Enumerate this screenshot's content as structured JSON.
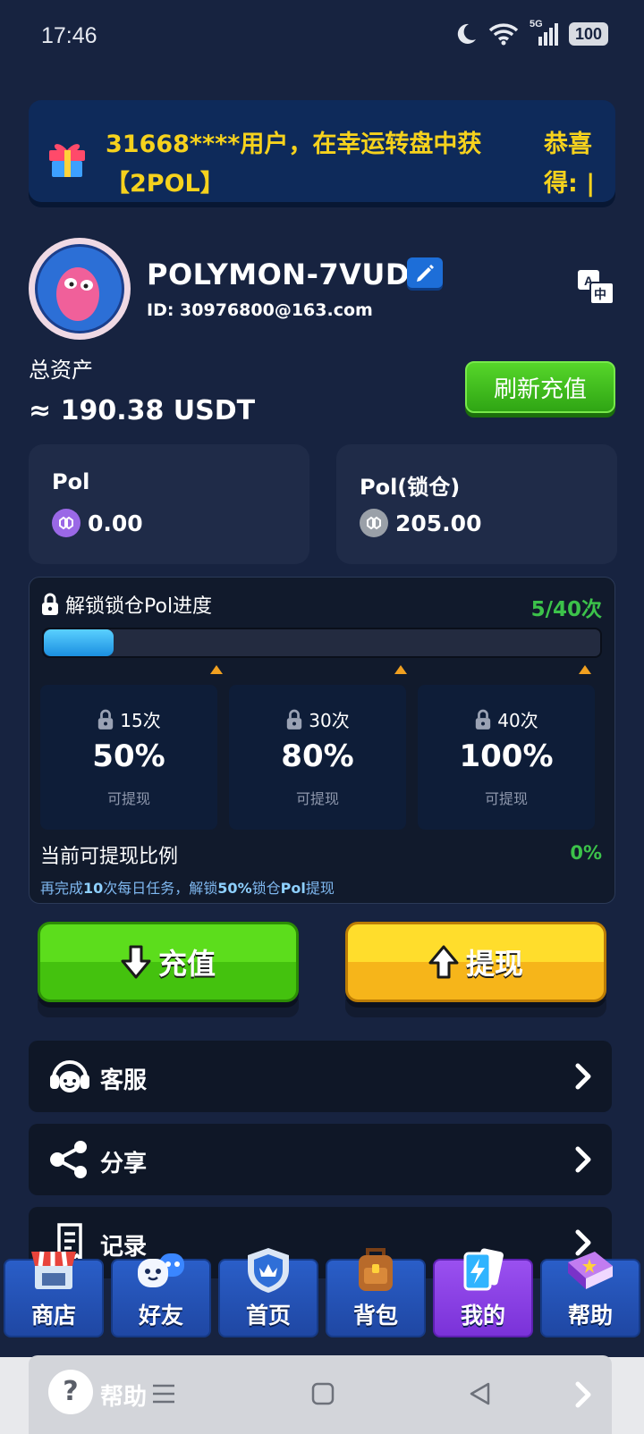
{
  "status_bar": {
    "time": "17:46",
    "network": "5G",
    "battery": "100"
  },
  "banner": {
    "text": "31668****用户，在幸运转盘中获得【2POL】",
    "text_line1": "31668****用户，在幸运转盘中获",
    "text_line2": "【2POL】",
    "right_line1": "恭喜",
    "right_line2": "得: |"
  },
  "profile": {
    "username": "POLYMON-7VUD3",
    "id": "ID: 30976800@163.com"
  },
  "assets": {
    "label": "总资产",
    "value": "≈ 190.38 USDT",
    "refresh_label": "刷新充值"
  },
  "balances": [
    {
      "title": "Pol",
      "value": "0.00",
      "coin_color": "#9a68e6"
    },
    {
      "title": "Pol(锁仓)",
      "value": "205.00",
      "coin_color": "#9aa0a8"
    }
  ],
  "progress": {
    "title": "解锁锁仓Pol进度",
    "count": "5/40次",
    "fraction": 0.125,
    "tiers": [
      {
        "times": "15次",
        "percent": "50%",
        "note": "可提现"
      },
      {
        "times": "30次",
        "percent": "80%",
        "note": "可提现"
      },
      {
        "times": "40次",
        "percent": "100%",
        "note": "可提现"
      }
    ],
    "ratio_label": "当前可提现比例",
    "ratio_value": "0%",
    "hint_a": "再完成",
    "hint_b": "10",
    "hint_c": "次每日任务，解锁",
    "hint_d": "50%",
    "hint_e": "锁仓",
    "hint_f": "Pol",
    "hint_g": "提现"
  },
  "actions": {
    "deposit": "充值",
    "withdraw": "提现"
  },
  "menu": [
    {
      "label": "客服",
      "icon": "headset-icon"
    },
    {
      "label": "分享",
      "icon": "share-icon"
    },
    {
      "label": "记录",
      "icon": "receipt-icon"
    },
    {
      "label": "帮助",
      "icon": "help-icon"
    }
  ],
  "bottom_nav": [
    {
      "label": "商店",
      "icon": "shop-icon"
    },
    {
      "label": "好友",
      "icon": "friends-icon"
    },
    {
      "label": "首页",
      "icon": "home-shield-icon"
    },
    {
      "label": "背包",
      "icon": "backpack-icon"
    },
    {
      "label": "我的",
      "icon": "cards-icon",
      "active": true
    },
    {
      "label": "帮助",
      "icon": "book-icon"
    }
  ]
}
